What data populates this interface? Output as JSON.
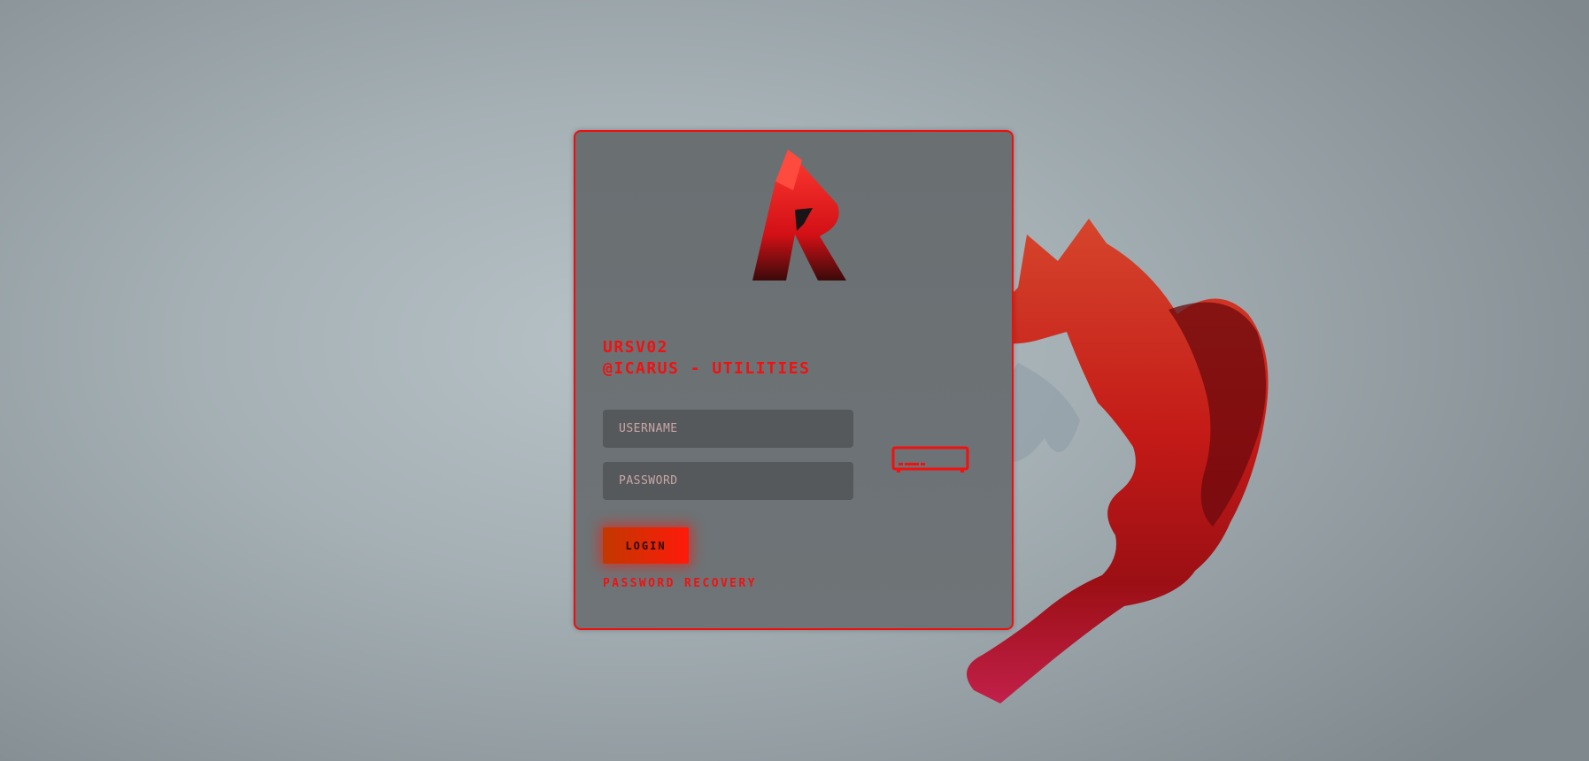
{
  "brand": {
    "logo_icon": "r-letter-logo-icon",
    "accent": "#f21010"
  },
  "panel": {
    "title_line1": "URSV02",
    "title_line2": "@ICARUS - UTILITIES"
  },
  "form": {
    "username_placeholder": "USERNAME",
    "password_placeholder": "PASSWORD",
    "login_label": "LOGIN",
    "recovery_label": "PASSWORD RECOVERY",
    "keyboard_icon": "keyboard-icon"
  },
  "background": {
    "illustration": "fox-silhouette-illustration"
  }
}
